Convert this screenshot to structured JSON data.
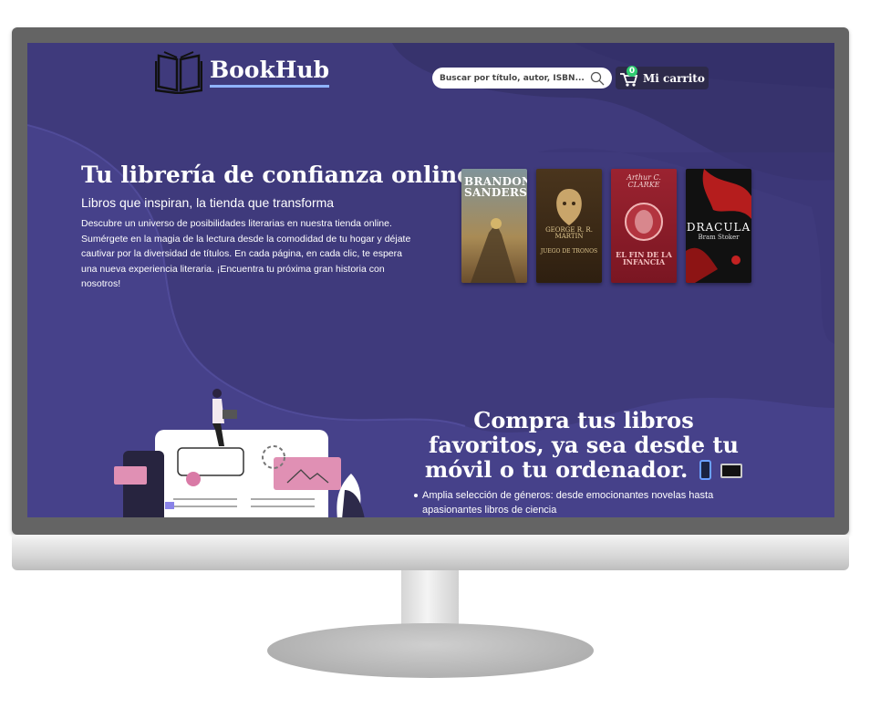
{
  "header": {
    "brand": "BookHub",
    "search_placeholder": "Buscar por título, autor, ISBN...",
    "cart_count": "0",
    "cart_label": "Mi carrito"
  },
  "hero": {
    "title": "Tu librería de confianza online",
    "subtitle": "Libros que inspiran, la tienda que transforma",
    "text": "Descubre un universo de posibilidades literarias en nuestra tienda online. Sumérgete en la magia de la lectura desde la comodidad de tu hogar y déjate cautivar por la diversidad de títulos. En cada página, en cada clic, te espera una nueva experiencia literaria. ¡Encuentra tu próxima gran historia con nosotros!"
  },
  "books": [
    {
      "author": "BRANDON SANDERSON",
      "title": "",
      "color": "#6e7f86"
    },
    {
      "author": "GEORGE R. R. MARTIN",
      "title": "JUEGO DE TRONOS",
      "color": "#3d2b17"
    },
    {
      "author": "Arthur C. CLARKE",
      "title": "EL FIN DE LA INFANCIA",
      "color": "#8e1f2c"
    },
    {
      "author": "Bram Stoker",
      "title": "DRACULA",
      "color": "#111111"
    }
  ],
  "section2": {
    "title": "Compra tus libros favoritos, ya sea desde tu móvil o tu ordenador.",
    "bullet": "Amplia selección de géneros: desde emocionantes novelas hasta apasionantes libros de ciencia"
  },
  "colors": {
    "background": "#37336d",
    "wave": "#4a4590",
    "accent": "#8fb3ff"
  },
  "icons": [
    "book-icon",
    "search-icon",
    "cart-icon",
    "phone-emoji",
    "laptop-emoji"
  ]
}
